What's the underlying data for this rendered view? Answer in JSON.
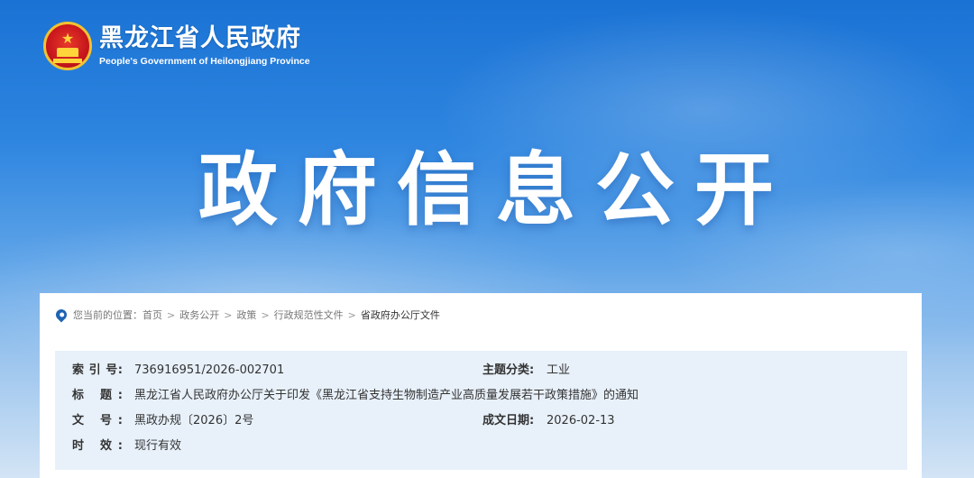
{
  "header": {
    "title_cn": "黑龙江省人民政府",
    "title_en": "People's Government of Heilongjiang Province"
  },
  "hero": {
    "title": "政府信息公开"
  },
  "breadcrumb": {
    "prefix": "您当前的位置：",
    "items": [
      "首页",
      "政务公开",
      "政策",
      "行政规范性文件",
      "省政府办公厅文件"
    ],
    "separator": ">"
  },
  "info": {
    "index_label": "索 引 号:",
    "index_value": "736916951/2026-002701",
    "topic_label": "主题分类:",
    "topic_value": "工业",
    "title_label": "标 题:",
    "title_value": "黑龙江省人民政府办公厅关于印发《黑龙江省支持生物制造产业高质量发展若干政策措施》的通知",
    "docno_label": "文 号:",
    "docno_value": "黑政办规〔2026〕2号",
    "date_label": "成文日期:",
    "date_value": "2026-02-13",
    "valid_label": "时 效:",
    "valid_value": "现行有效"
  },
  "colors": {
    "banner_top": "#1a72d4",
    "banner_bottom": "#d3e4f5",
    "info_bg": "#e8f1fa",
    "pin": "#1e64b4"
  },
  "icons": {
    "location": "location-pin-icon",
    "emblem": "national-emblem-icon"
  }
}
